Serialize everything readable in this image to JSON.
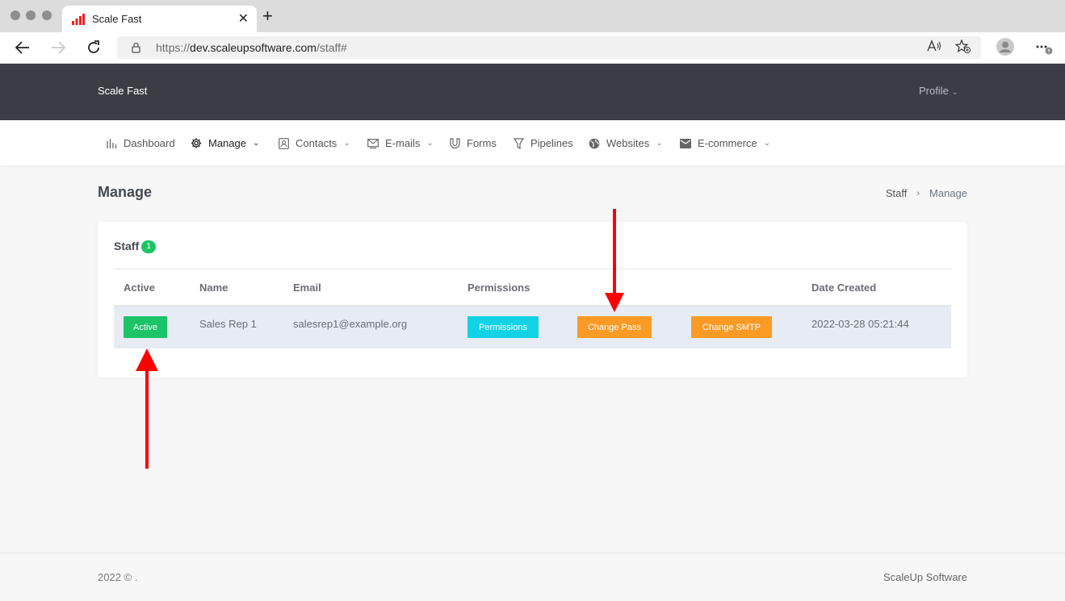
{
  "browser": {
    "tab_title": "Scale Fast",
    "url_scheme": "https://",
    "url_domain": "dev.scaleupsoftware.com",
    "url_path": "/staff#"
  },
  "header": {
    "brand": "Scale Fast",
    "profile_label": "Profile"
  },
  "nav": {
    "items": [
      {
        "label": "Dashboard",
        "icon": "bar-chart-icon",
        "dropdown": false
      },
      {
        "label": "Manage",
        "icon": "gear-icon",
        "dropdown": true,
        "active": true
      },
      {
        "label": "Contacts",
        "icon": "contact-card-icon",
        "dropdown": true
      },
      {
        "label": "E-mails",
        "icon": "mail-send-icon",
        "dropdown": true
      },
      {
        "label": "Forms",
        "icon": "magnet-icon",
        "dropdown": false
      },
      {
        "label": "Pipelines",
        "icon": "filter-icon",
        "dropdown": false
      },
      {
        "label": "Websites",
        "icon": "globe-icon",
        "dropdown": true
      },
      {
        "label": "E-commerce",
        "icon": "envelope-icon",
        "dropdown": true
      }
    ]
  },
  "page": {
    "title": "Manage",
    "breadcrumb": {
      "parent": "Staff",
      "current": "Manage"
    }
  },
  "staff_card": {
    "title": "Staff",
    "count": "1",
    "columns": {
      "active": "Active",
      "name": "Name",
      "email": "Email",
      "permissions": "Permissions",
      "date_created": "Date Created"
    },
    "rows": [
      {
        "status": "Active",
        "name": "Sales Rep 1",
        "email": "salesrep1@example.org",
        "permissions_btn": "Permissions",
        "change_pass_btn": "Change Pass",
        "change_smtp_btn": "Change SMTP",
        "date_created": "2022-03-28 05:21:44"
      }
    ]
  },
  "footer": {
    "copyright": "2022 © .",
    "company": "ScaleUp Software"
  },
  "colors": {
    "header_bg": "#3b3d44",
    "active_green": "#1bc466",
    "permissions_cyan": "#12d3e6",
    "action_orange": "#fb9a24",
    "annotation_red": "#ff0000"
  }
}
